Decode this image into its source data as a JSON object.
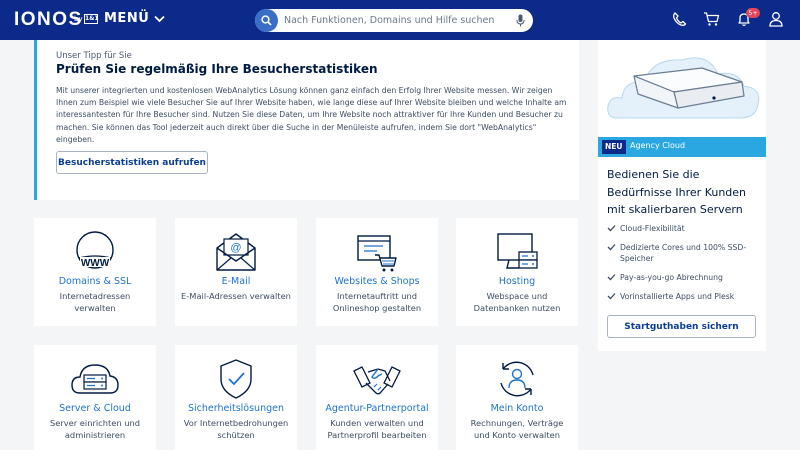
{
  "header": {
    "logo": "IONOS",
    "logo_by": "by",
    "logo_box": "1&1",
    "menu_label": "MENÜ",
    "search_placeholder": "Nach Funktionen, Domains und Hilfe suchen",
    "notification_badge": "5+",
    "icons": [
      "search-icon",
      "microphone-icon",
      "phone-icon",
      "cart-icon",
      "bell-icon",
      "user-icon"
    ]
  },
  "tip": {
    "eyebrow": "Unser Tipp für Sie",
    "title": "Prüfen Sie regelmäßig Ihre Besucherstatistiken",
    "body": "Mit unserer integrierten und kostenlosen WebAnalytics Lösung können ganz einfach den Erfolg Ihrer Website messen. Wir zeigen Ihnen zum Beispiel wie viele Besucher Sie auf Ihrer Website haben, wie lange diese auf Ihrer Website bleiben und welche Inhalte am interessantesten für Ihre Besucher sind. Nutzen Sie diese Daten, um Ihre Website noch attraktiver für Ihre Kunden und Besucher zu machen. Sie können das Tool jederzeit auch direkt über die Suche in der Menüleiste aufrufen, indem Sie dort \"WebAnalytics\" eingeben.",
    "button": "Besucherstatistiken aufrufen"
  },
  "tiles": [
    {
      "title": "Domains & SSL",
      "desc": "Internetadressen verwalten",
      "icon": "globe-www-icon"
    },
    {
      "title": "E-Mail",
      "desc": "E-Mail-Adressen verwalten",
      "icon": "envelope-icon"
    },
    {
      "title": "Websites & Shops",
      "desc": "Internetauftritt und Onlineshop gestalten",
      "icon": "website-cart-icon"
    },
    {
      "title": "Hosting",
      "desc": "Webspace und Datenbanken nutzen",
      "icon": "monitor-server-icon"
    },
    {
      "title": "Server & Cloud",
      "desc": "Server einrichten und administrieren",
      "icon": "cloud-server-icon"
    },
    {
      "title": "Sicherheitslösungen",
      "desc": "Vor Internetbedrohungen schützen",
      "icon": "shield-check-icon"
    },
    {
      "title": "Agentur-Partnerportal",
      "desc": "Kunden verwalten und Partnerprofil bearbeiten",
      "icon": "handshake-icon"
    },
    {
      "title": "Mein Konto",
      "desc": "Rechnungen, Verträge und Konto verwalten",
      "icon": "account-circle-icon"
    }
  ],
  "promo": {
    "new_badge": "NEU",
    "tag": "Agency Cloud",
    "title": "Bedienen Sie die Bedürfnisse Ihrer Kunden mit skalierbaren Servern",
    "features": [
      "Cloud-Flexibilität",
      "Dedizierte Cores und 100% SSD-Speicher",
      "Pay-as-you-go Abrechnung",
      "Vorinstallierte Apps und Plesk"
    ],
    "button": "Startguthaben sichern"
  },
  "colors": {
    "header": "#0b2a8a",
    "accent": "#2aa7e0",
    "link": "#1f73c9",
    "badge": "#e3455b"
  }
}
